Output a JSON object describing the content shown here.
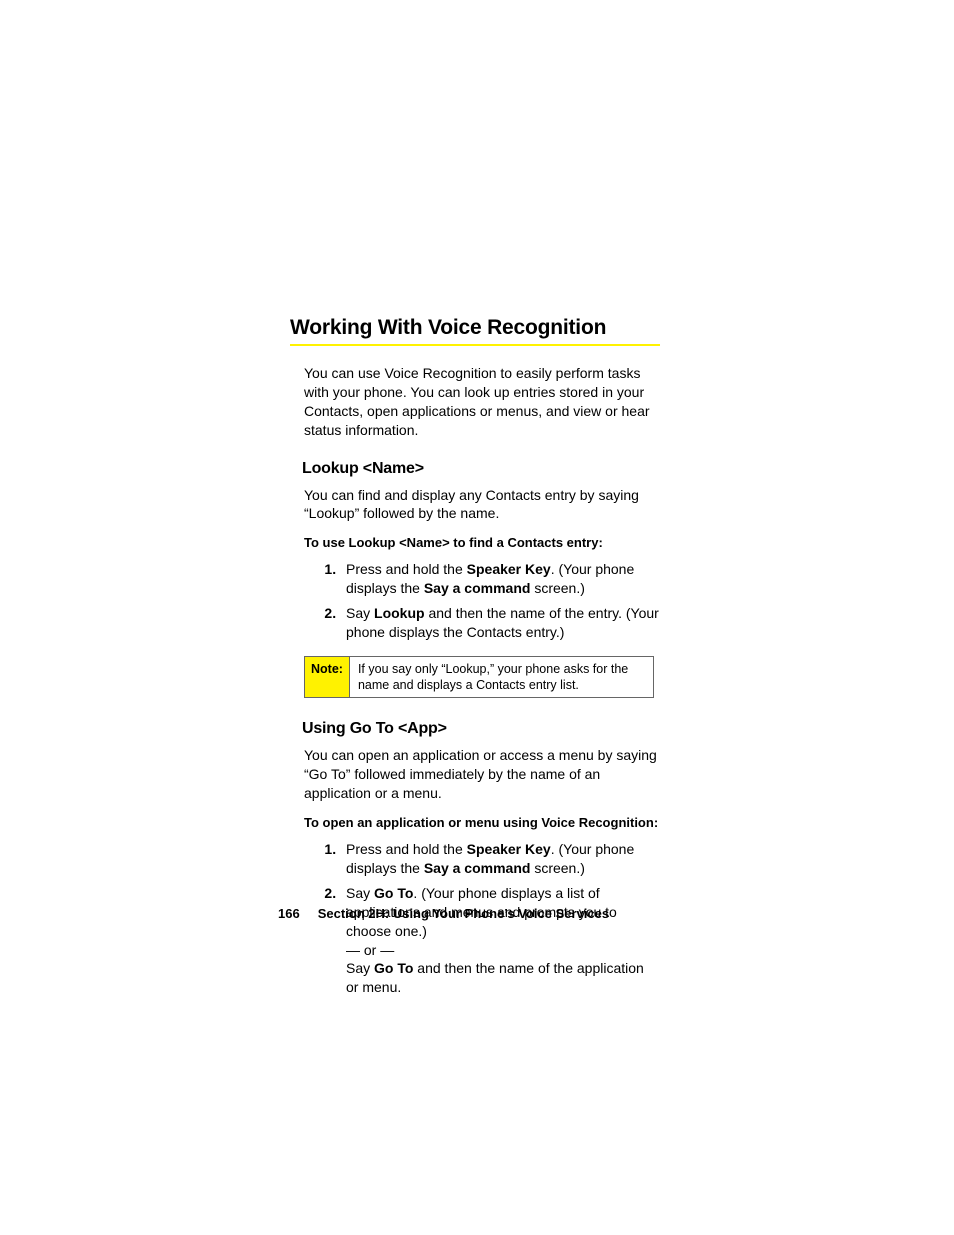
{
  "title": "Working With Voice Recognition",
  "intro": "You can use Voice Recognition to easily perform tasks with your phone. You can look up entries stored in your Contacts, open applications or menus, and view or hear status information.",
  "section1": {
    "heading": "Lookup <Name>",
    "body": "You can find and display any Contacts entry by saying “Lookup” followed by the name.",
    "instr_title": "To use Lookup <Name> to find a Contacts entry:",
    "step1_a": "Press and hold the ",
    "step1_b": "Speaker Key",
    "step1_c": ". (Your phone displays the ",
    "step1_d": "Say a command",
    "step1_e": " screen.)",
    "step2_a": "Say ",
    "step2_b": "Lookup",
    "step2_c": " and then the name of the entry. (Your phone displays the Contacts entry.)",
    "note_label": "Note:",
    "note_body": "If you say only “Lookup,” your phone asks for the name and displays a Contacts entry list."
  },
  "section2": {
    "heading": "Using Go To <App>",
    "body": "You can open an application or access a menu by saying “Go To” followed immediately by the name of an application or a menu.",
    "instr_title": "To open an application or menu using Voice Recognition:",
    "step1_a": "Press and hold the ",
    "step1_b": "Speaker Key",
    "step1_c": ". (Your phone displays the ",
    "step1_d": "Say a command",
    "step1_e": " screen.)",
    "step2_a": "Say ",
    "step2_b": "Go To",
    "step2_c": ". (Your phone displays a list of applications and menus and prompts you to choose one.)",
    "step2_or": "— or —",
    "step2_d": "Say ",
    "step2_e": "Go To",
    "step2_f": " and then the name of the application or menu."
  },
  "footer": {
    "page_num": "166",
    "section_label": "Section 2H: Using Your Phone’s Voice Services"
  }
}
